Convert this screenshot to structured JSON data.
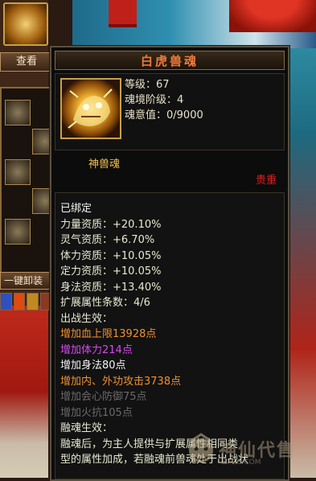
{
  "left_panel": {
    "view_button": "查看",
    "unequip_button": "一键卸装"
  },
  "tooltip": {
    "title": "白虎兽魂",
    "stats": {
      "level": "等级：67",
      "realm": "魂境阶级：4",
      "soul_value": "魂意值：0/9000"
    },
    "item_type": "神兽魂",
    "rarity": "贵重",
    "attributes": [
      {
        "text": "已绑定",
        "color": "white"
      },
      {
        "text": "力量资质：+20.10%",
        "color": "cream"
      },
      {
        "text": "灵气资质：+6.70%",
        "color": "cream"
      },
      {
        "text": "体力资质：+10.05%",
        "color": "cream"
      },
      {
        "text": "定力资质：+10.05%",
        "color": "cream"
      },
      {
        "text": "身法资质：+13.40%",
        "color": "cream"
      },
      {
        "text": "扩展属性条数：4/6",
        "color": "cream"
      },
      {
        "text": "出战生效：",
        "color": "cream"
      },
      {
        "text": "增加血上限13928点",
        "color": "orange"
      },
      {
        "text": "增加体力214点",
        "color": "purple"
      },
      {
        "text": "增加身法80点",
        "color": "white"
      },
      {
        "text": "增加内、外功攻击3738点",
        "color": "orange"
      },
      {
        "text": "增加会心防御75点",
        "color": "gray"
      },
      {
        "text": "增加火抗105点",
        "color": "gray"
      },
      {
        "text": "融魂生效：",
        "color": "cream"
      },
      {
        "text": "融魂后，为主人提供与扩展属性相同类",
        "color": "cream"
      },
      {
        "text": "型的属性加成，若融魂前兽魂处于出战状",
        "color": "cream"
      }
    ]
  },
  "watermark": {
    "text": "神仙代售",
    "url": "SXDS.COM"
  },
  "colors": {
    "title": "#f07a3a",
    "item_type": "#f0c050",
    "rarity": "#e02020",
    "orange": "#f09030",
    "purple": "#d848f0"
  }
}
